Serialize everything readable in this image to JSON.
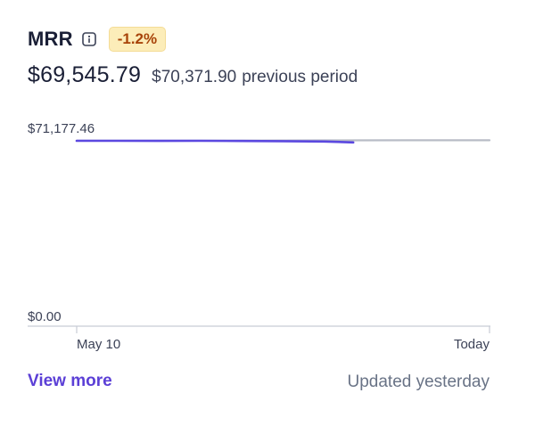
{
  "metric": {
    "title": "MRR",
    "change_badge": "-1.2%",
    "current_value": "$69,545.79",
    "previous_value": "$70,371.90",
    "previous_suffix": "previous period"
  },
  "chart_data": {
    "type": "line",
    "y_tick_labels": [
      "$71,177.46",
      "$0.00"
    ],
    "ylim": [
      0,
      71177.46
    ],
    "x_tick_labels": [
      "May 10",
      "Today"
    ],
    "series": [
      {
        "role": "current",
        "color": "#5b48e0",
        "points": [
          [
            0,
            70180
          ],
          [
            0.1,
            70150
          ],
          [
            0.2,
            70120
          ],
          [
            0.3,
            70160
          ],
          [
            0.4,
            70100
          ],
          [
            0.5,
            70020
          ],
          [
            0.6,
            69900
          ],
          [
            0.67,
            69545.79
          ]
        ]
      },
      {
        "role": "previous",
        "color": "#b8bcc6",
        "points": [
          [
            0,
            70200
          ],
          [
            0.2,
            70230
          ],
          [
            0.4,
            70260
          ],
          [
            0.6,
            70320
          ],
          [
            0.8,
            70380
          ],
          [
            1.0,
            70371.9
          ]
        ]
      }
    ]
  },
  "footer": {
    "view_more_label": "View more",
    "updated_text": "Updated yesterday"
  },
  "colors": {
    "accent": "#5b3fd6",
    "badge_bg": "#fcedb9",
    "badge_text": "#a8440a"
  },
  "icons": {
    "info": "info-icon"
  }
}
